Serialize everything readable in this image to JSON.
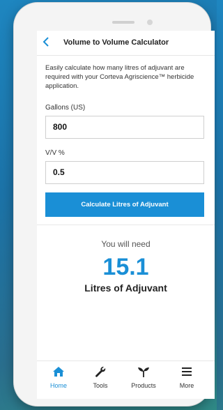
{
  "header": {
    "title": "Volume to Volume Calculator"
  },
  "description": "Easily calculate how many litres of adjuvant are required with your Corteva Agriscience™ herbicide application.",
  "form": {
    "gallons_label": "Gallons (US)",
    "gallons_value": "800",
    "vv_label": "V/V %",
    "vv_value": "0.5",
    "calculate_label": "Calculate Litres of Adjuvant"
  },
  "result": {
    "intro": "You will need",
    "value": "15.1",
    "unit": "Litres of Adjuvant"
  },
  "tabs": [
    {
      "label": "Home",
      "icon": "home-icon",
      "active": true
    },
    {
      "label": "Tools",
      "icon": "wrench-icon",
      "active": false
    },
    {
      "label": "Products",
      "icon": "plant-icon",
      "active": false
    },
    {
      "label": "More",
      "icon": "menu-icon",
      "active": false
    }
  ],
  "colors": {
    "accent": "#1a8fd6"
  }
}
